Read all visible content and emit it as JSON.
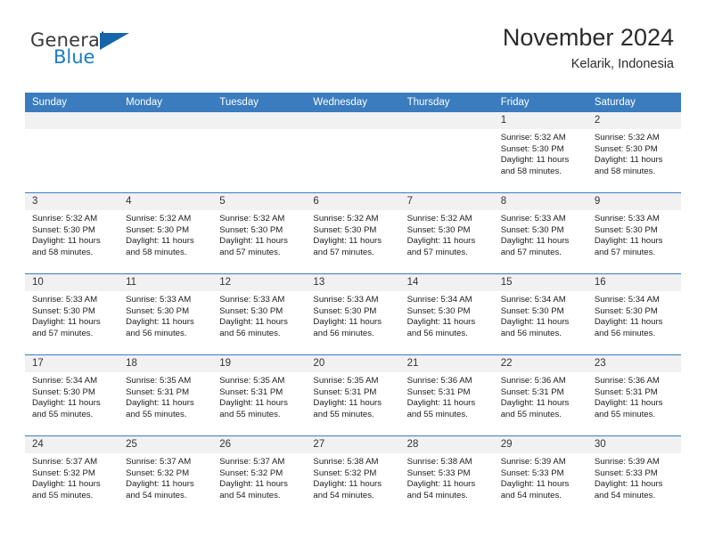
{
  "brand": {
    "name_top": "General",
    "name_bottom": "Blue",
    "color_dark": "#3b3b3b",
    "color_blue": "#1a7dc4",
    "triangle_color": "#1565a8"
  },
  "header": {
    "title": "November 2024",
    "subtitle": "Kelarik, Indonesia",
    "accent_color": "#3a7cbe",
    "daynumber_band_color": "#f1f1f1"
  },
  "weekday_headers": [
    "Sunday",
    "Monday",
    "Tuesday",
    "Wednesday",
    "Thursday",
    "Friday",
    "Saturday"
  ],
  "weeks": [
    [
      {
        "day": "",
        "empty": true,
        "sunrise": "",
        "sunset": "",
        "daylight_line1": "",
        "daylight_line2": ""
      },
      {
        "day": "",
        "empty": true,
        "sunrise": "",
        "sunset": "",
        "daylight_line1": "",
        "daylight_line2": ""
      },
      {
        "day": "",
        "empty": true,
        "sunrise": "",
        "sunset": "",
        "daylight_line1": "",
        "daylight_line2": ""
      },
      {
        "day": "",
        "empty": true,
        "sunrise": "",
        "sunset": "",
        "daylight_line1": "",
        "daylight_line2": ""
      },
      {
        "day": "",
        "empty": true,
        "sunrise": "",
        "sunset": "",
        "daylight_line1": "",
        "daylight_line2": ""
      },
      {
        "day": "1",
        "sunrise": "Sunrise: 5:32 AM",
        "sunset": "Sunset: 5:30 PM",
        "daylight_line1": "Daylight: 11 hours",
        "daylight_line2": "and 58 minutes."
      },
      {
        "day": "2",
        "sunrise": "Sunrise: 5:32 AM",
        "sunset": "Sunset: 5:30 PM",
        "daylight_line1": "Daylight: 11 hours",
        "daylight_line2": "and 58 minutes."
      }
    ],
    [
      {
        "day": "3",
        "sunrise": "Sunrise: 5:32 AM",
        "sunset": "Sunset: 5:30 PM",
        "daylight_line1": "Daylight: 11 hours",
        "daylight_line2": "and 58 minutes."
      },
      {
        "day": "4",
        "sunrise": "Sunrise: 5:32 AM",
        "sunset": "Sunset: 5:30 PM",
        "daylight_line1": "Daylight: 11 hours",
        "daylight_line2": "and 58 minutes."
      },
      {
        "day": "5",
        "sunrise": "Sunrise: 5:32 AM",
        "sunset": "Sunset: 5:30 PM",
        "daylight_line1": "Daylight: 11 hours",
        "daylight_line2": "and 57 minutes."
      },
      {
        "day": "6",
        "sunrise": "Sunrise: 5:32 AM",
        "sunset": "Sunset: 5:30 PM",
        "daylight_line1": "Daylight: 11 hours",
        "daylight_line2": "and 57 minutes."
      },
      {
        "day": "7",
        "sunrise": "Sunrise: 5:32 AM",
        "sunset": "Sunset: 5:30 PM",
        "daylight_line1": "Daylight: 11 hours",
        "daylight_line2": "and 57 minutes."
      },
      {
        "day": "8",
        "sunrise": "Sunrise: 5:33 AM",
        "sunset": "Sunset: 5:30 PM",
        "daylight_line1": "Daylight: 11 hours",
        "daylight_line2": "and 57 minutes."
      },
      {
        "day": "9",
        "sunrise": "Sunrise: 5:33 AM",
        "sunset": "Sunset: 5:30 PM",
        "daylight_line1": "Daylight: 11 hours",
        "daylight_line2": "and 57 minutes."
      }
    ],
    [
      {
        "day": "10",
        "sunrise": "Sunrise: 5:33 AM",
        "sunset": "Sunset: 5:30 PM",
        "daylight_line1": "Daylight: 11 hours",
        "daylight_line2": "and 57 minutes."
      },
      {
        "day": "11",
        "sunrise": "Sunrise: 5:33 AM",
        "sunset": "Sunset: 5:30 PM",
        "daylight_line1": "Daylight: 11 hours",
        "daylight_line2": "and 56 minutes."
      },
      {
        "day": "12",
        "sunrise": "Sunrise: 5:33 AM",
        "sunset": "Sunset: 5:30 PM",
        "daylight_line1": "Daylight: 11 hours",
        "daylight_line2": "and 56 minutes."
      },
      {
        "day": "13",
        "sunrise": "Sunrise: 5:33 AM",
        "sunset": "Sunset: 5:30 PM",
        "daylight_line1": "Daylight: 11 hours",
        "daylight_line2": "and 56 minutes."
      },
      {
        "day": "14",
        "sunrise": "Sunrise: 5:34 AM",
        "sunset": "Sunset: 5:30 PM",
        "daylight_line1": "Daylight: 11 hours",
        "daylight_line2": "and 56 minutes."
      },
      {
        "day": "15",
        "sunrise": "Sunrise: 5:34 AM",
        "sunset": "Sunset: 5:30 PM",
        "daylight_line1": "Daylight: 11 hours",
        "daylight_line2": "and 56 minutes."
      },
      {
        "day": "16",
        "sunrise": "Sunrise: 5:34 AM",
        "sunset": "Sunset: 5:30 PM",
        "daylight_line1": "Daylight: 11 hours",
        "daylight_line2": "and 56 minutes."
      }
    ],
    [
      {
        "day": "17",
        "sunrise": "Sunrise: 5:34 AM",
        "sunset": "Sunset: 5:30 PM",
        "daylight_line1": "Daylight: 11 hours",
        "daylight_line2": "and 55 minutes."
      },
      {
        "day": "18",
        "sunrise": "Sunrise: 5:35 AM",
        "sunset": "Sunset: 5:31 PM",
        "daylight_line1": "Daylight: 11 hours",
        "daylight_line2": "and 55 minutes."
      },
      {
        "day": "19",
        "sunrise": "Sunrise: 5:35 AM",
        "sunset": "Sunset: 5:31 PM",
        "daylight_line1": "Daylight: 11 hours",
        "daylight_line2": "and 55 minutes."
      },
      {
        "day": "20",
        "sunrise": "Sunrise: 5:35 AM",
        "sunset": "Sunset: 5:31 PM",
        "daylight_line1": "Daylight: 11 hours",
        "daylight_line2": "and 55 minutes."
      },
      {
        "day": "21",
        "sunrise": "Sunrise: 5:36 AM",
        "sunset": "Sunset: 5:31 PM",
        "daylight_line1": "Daylight: 11 hours",
        "daylight_line2": "and 55 minutes."
      },
      {
        "day": "22",
        "sunrise": "Sunrise: 5:36 AM",
        "sunset": "Sunset: 5:31 PM",
        "daylight_line1": "Daylight: 11 hours",
        "daylight_line2": "and 55 minutes."
      },
      {
        "day": "23",
        "sunrise": "Sunrise: 5:36 AM",
        "sunset": "Sunset: 5:31 PM",
        "daylight_line1": "Daylight: 11 hours",
        "daylight_line2": "and 55 minutes."
      }
    ],
    [
      {
        "day": "24",
        "sunrise": "Sunrise: 5:37 AM",
        "sunset": "Sunset: 5:32 PM",
        "daylight_line1": "Daylight: 11 hours",
        "daylight_line2": "and 55 minutes."
      },
      {
        "day": "25",
        "sunrise": "Sunrise: 5:37 AM",
        "sunset": "Sunset: 5:32 PM",
        "daylight_line1": "Daylight: 11 hours",
        "daylight_line2": "and 54 minutes."
      },
      {
        "day": "26",
        "sunrise": "Sunrise: 5:37 AM",
        "sunset": "Sunset: 5:32 PM",
        "daylight_line1": "Daylight: 11 hours",
        "daylight_line2": "and 54 minutes."
      },
      {
        "day": "27",
        "sunrise": "Sunrise: 5:38 AM",
        "sunset": "Sunset: 5:32 PM",
        "daylight_line1": "Daylight: 11 hours",
        "daylight_line2": "and 54 minutes."
      },
      {
        "day": "28",
        "sunrise": "Sunrise: 5:38 AM",
        "sunset": "Sunset: 5:33 PM",
        "daylight_line1": "Daylight: 11 hours",
        "daylight_line2": "and 54 minutes."
      },
      {
        "day": "29",
        "sunrise": "Sunrise: 5:39 AM",
        "sunset": "Sunset: 5:33 PM",
        "daylight_line1": "Daylight: 11 hours",
        "daylight_line2": "and 54 minutes."
      },
      {
        "day": "30",
        "sunrise": "Sunrise: 5:39 AM",
        "sunset": "Sunset: 5:33 PM",
        "daylight_line1": "Daylight: 11 hours",
        "daylight_line2": "and 54 minutes."
      }
    ]
  ]
}
